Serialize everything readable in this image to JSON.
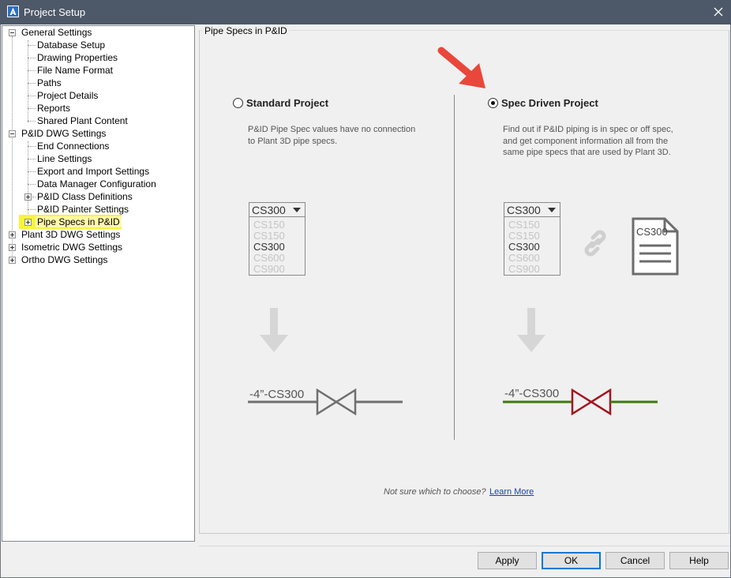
{
  "window": {
    "title": "Project Setup"
  },
  "tree": {
    "items": [
      {
        "label": "General Settings"
      },
      {
        "label": "Database Setup"
      },
      {
        "label": "Drawing Properties"
      },
      {
        "label": "File Name Format"
      },
      {
        "label": "Paths"
      },
      {
        "label": "Project Details"
      },
      {
        "label": "Reports"
      },
      {
        "label": "Shared Plant Content"
      },
      {
        "label": "P&ID DWG Settings"
      },
      {
        "label": "End Connections"
      },
      {
        "label": "Line Settings"
      },
      {
        "label": "Export and Import Settings"
      },
      {
        "label": "Data Manager Configuration"
      },
      {
        "label": "P&ID Class Definitions"
      },
      {
        "label": "P&ID Painter Settings"
      },
      {
        "label": "Pipe Specs in P&ID"
      },
      {
        "label": "Plant 3D DWG Settings"
      },
      {
        "label": "Isometric DWG Settings"
      },
      {
        "label": "Ortho DWG Settings"
      }
    ]
  },
  "panel": {
    "group_title": "Pipe Specs in P&ID",
    "standard": {
      "label": "Standard Project",
      "desc_line1": "P&ID Pipe Spec values have no connection",
      "desc_line2": "to Plant 3D pipe specs.",
      "spec_selected": "CS300",
      "spec_options": [
        "CS150",
        "CS150",
        "CS300",
        "CS600",
        "CS900"
      ],
      "pipe_label": "-4”-CS300"
    },
    "spec_driven": {
      "label": "Spec Driven Project",
      "desc_line1": "Find out if P&ID piping is in spec or off spec,",
      "desc_line2": "and get component information all from the",
      "desc_line3": "same pipe specs that are used by Plant 3D.",
      "spec_selected": "CS300",
      "spec_options": [
        "CS150",
        "CS150",
        "CS300",
        "CS600",
        "CS900"
      ],
      "doc_label": "CS300",
      "pipe_label": "-4”-CS300"
    },
    "footnote": "Not sure which to choose?",
    "learn_more": "Learn More"
  },
  "buttons": {
    "apply": "Apply",
    "ok": "OK",
    "cancel": "Cancel",
    "help": "Help"
  },
  "colors": {
    "titlebar": "#4d5868",
    "highlight": "#f7f43a",
    "arrow": "#e9473b",
    "valve_off": "#666666",
    "valve_on": "#a3141c",
    "pipe_green": "#3c7a0b",
    "link": "#1a3fa6"
  },
  "icons": [
    "autocad-a-icon",
    "close-icon",
    "arrow-annotation-icon",
    "down-arrow-icon",
    "chain-link-icon",
    "document-icon",
    "gate-valve-icon"
  ]
}
